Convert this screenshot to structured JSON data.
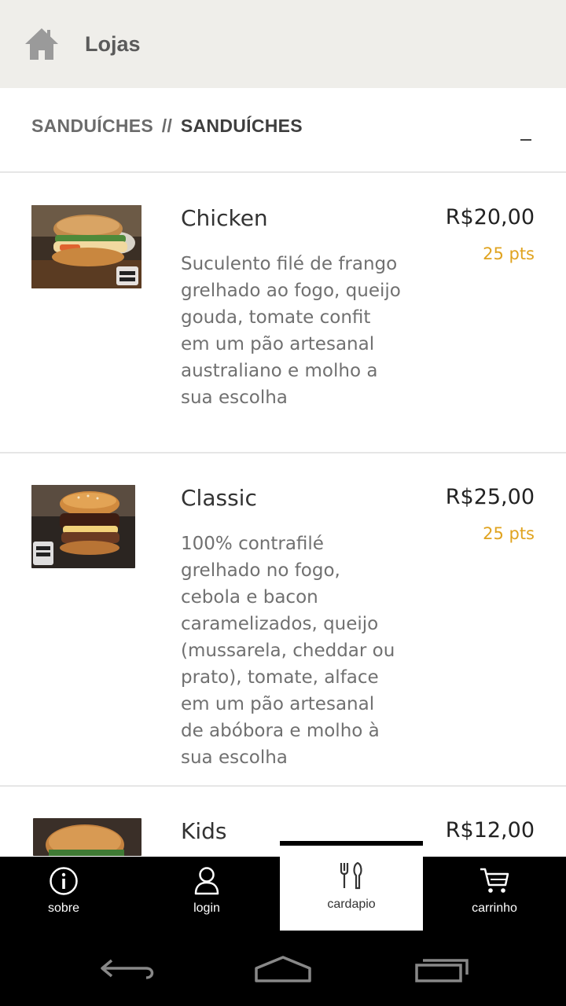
{
  "header": {
    "title": "Lojas",
    "home_icon": "home-icon"
  },
  "section": {
    "category": "SANDUÍCHES",
    "separator": "//",
    "subcategory": "SANDUÍCHES",
    "collapse_icon": "minus-icon"
  },
  "items": [
    {
      "name": "Chicken",
      "description": "Suculento filé de frango grelhado ao fogo, queijo gouda, tomate confit em um pão artesanal australiano e molho a sua escolha",
      "price": "R$20,00",
      "points": "25 pts",
      "image": "chicken-burger-photo"
    },
    {
      "name": "Classic",
      "description": "100% contrafilé grelhado no fogo, cebola e bacon caramelizados, queijo (mussarela, cheddar ou prato), tomate, alface em um pão artesanal de abóbora e molho à sua escolha",
      "price": "R$25,00",
      "points": "25 pts",
      "image": "classic-burger-photo"
    },
    {
      "name": "Kids",
      "description": "",
      "price": "R$12,00",
      "points": "",
      "image": "kids-burger-photo"
    }
  ],
  "bottom_nav": [
    {
      "label": "sobre",
      "icon": "info-icon",
      "active": false
    },
    {
      "label": "login",
      "icon": "user-icon",
      "active": false
    },
    {
      "label": "cardapio",
      "icon": "cutlery-icon",
      "active": true
    },
    {
      "label": "carrinho",
      "icon": "cart-icon",
      "active": false
    }
  ],
  "system_nav": [
    "back-icon",
    "home-outline-icon",
    "recent-apps-icon"
  ],
  "colors": {
    "topbar_bg": "#efeeea",
    "points": "#e0a31f",
    "nav_bg": "#000000"
  }
}
